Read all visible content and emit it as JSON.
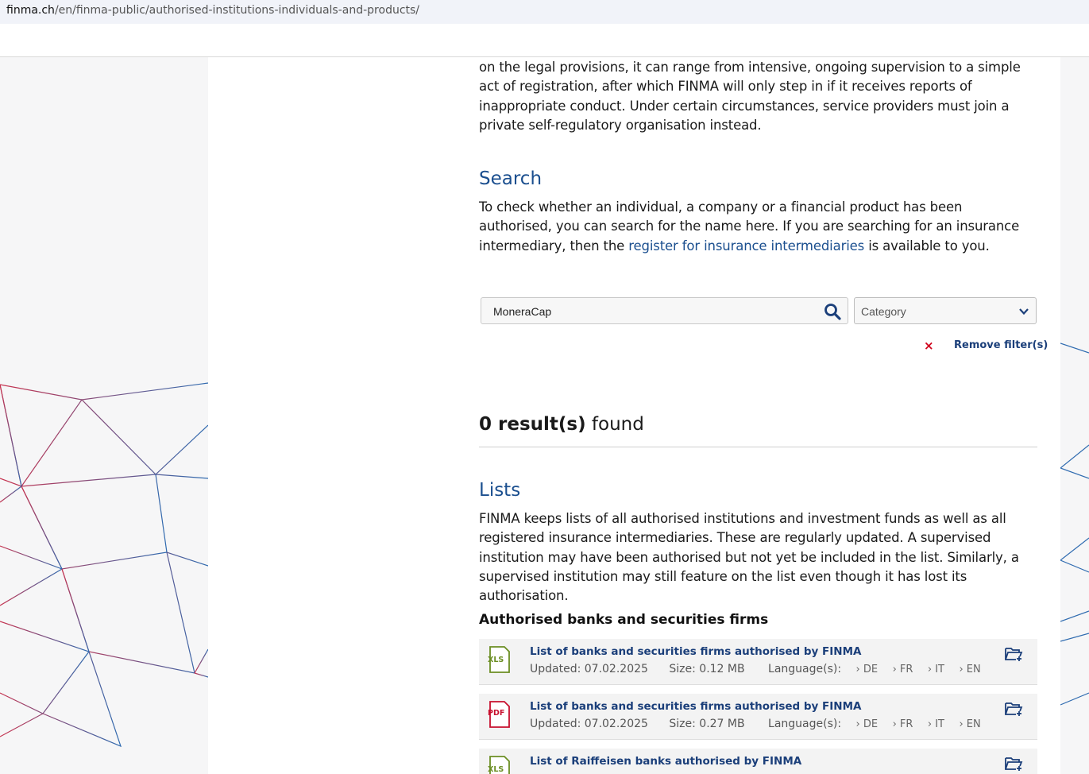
{
  "browser": {
    "url_domain": "finma.ch",
    "url_path": "/en/finma-public/authorised-institutions-individuals-and-products/"
  },
  "intro": {
    "text": "on the legal provisions, it can range from intensive, ongoing supervision to a simple act of registration, after which FINMA will only step in if it receives reports of inappropriate conduct. Under certain circumstances, service providers must join a private self-regulatory organisation instead."
  },
  "search": {
    "heading": "Search",
    "text_before": "To check whether an individual, a company or a financial product has been authorised, you can search for the name here. If you are searching for an insurance intermediary, then the ",
    "link": "register for insurance intermediaries",
    "text_after": " is available to you.",
    "input_value": "MoneraCap",
    "category_placeholder": "Category",
    "remove_icon": "×",
    "remove_label": "Remove filter(s)"
  },
  "results": {
    "count": "0 result(s)",
    "suffix": " found"
  },
  "lists": {
    "heading": "Lists",
    "text": "FINMA keeps lists of all authorised institutions and investment funds as well as all registered insurance intermediaries. These are regularly updated. A supervised institution may have been authorised but not yet be included in the list. Similarly, a supervised institution may still feature on the list even though it has lost its authorisation.",
    "subheading": "Authorised banks and securities firms",
    "items": [
      {
        "type": "XLS",
        "title": "List of banks and securities firms authorised by FINMA",
        "updated": "Updated: 07.02.2025",
        "size": "Size: 0.12  MB",
        "languages_label": "Language(s):",
        "languages": [
          "DE",
          "FR",
          "IT",
          "EN"
        ]
      },
      {
        "type": "PDF",
        "title": "List of banks and securities firms authorised by FINMA",
        "updated": "Updated: 07.02.2025",
        "size": "Size: 0.27  MB",
        "languages_label": "Language(s):",
        "languages": [
          "DE",
          "FR",
          "IT",
          "EN"
        ]
      },
      {
        "type": "XLS",
        "title": "List of Raiffeisen banks authorised by FINMA"
      }
    ]
  },
  "colors": {
    "link": "#1b4f8f",
    "title": "#1b3f7a",
    "remove_x": "#d0021b",
    "xls": "#6b8e23",
    "pdf": "#c8102e"
  }
}
